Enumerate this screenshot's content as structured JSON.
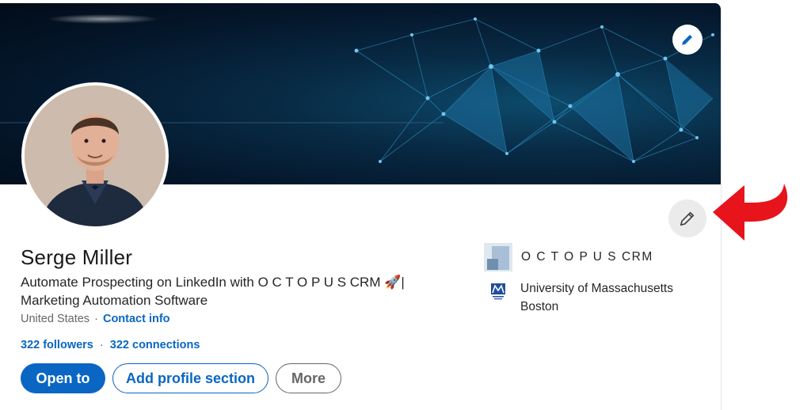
{
  "profile": {
    "name": "Serge Miller",
    "headline": "Automate Prospecting on LinkedIn with O C T O P U S CRM 🚀| Marketing Automation Software",
    "location": "United States",
    "separator": "·",
    "contact_label": "Contact info",
    "followers_label": "322 followers",
    "connections_label": "322 connections"
  },
  "actions": {
    "open_to_label": "Open to",
    "add_section_label": "Add profile section",
    "more_label": "More"
  },
  "experience": [
    {
      "label": "O C T O P U S CRM",
      "logo": "octopus-crm-logo"
    },
    {
      "label": "University of Massachusetts Boston",
      "logo": "umass-boston-logo"
    }
  ],
  "icons": {
    "banner_edit": "pencil-icon",
    "intro_edit": "pencil-icon",
    "annotation": "red-curved-arrow-icon"
  },
  "colors": {
    "brand_blue": "#0a66c2",
    "annotation_red": "#e8141b",
    "banner_dark": "#04162a"
  }
}
